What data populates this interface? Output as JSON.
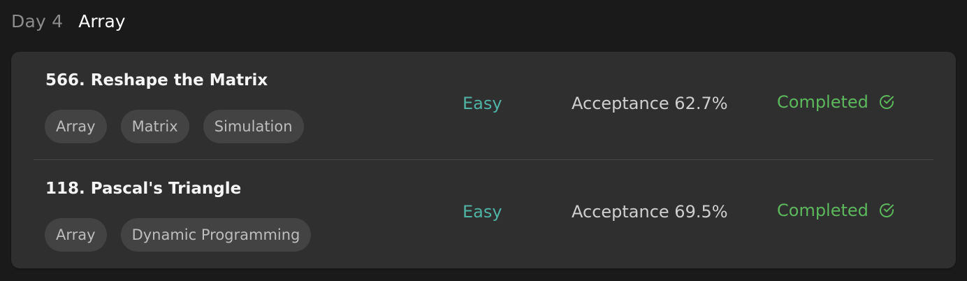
{
  "header": {
    "day_label": "Day 4",
    "section_title": "Array"
  },
  "problems": [
    {
      "title": "566. Reshape the Matrix",
      "tags": [
        "Array",
        "Matrix",
        "Simulation"
      ],
      "difficulty": "Easy",
      "acceptance": "Acceptance 62.7%",
      "status": "Completed",
      "status_icon": "check-circle-icon"
    },
    {
      "title": "118. Pascal's Triangle",
      "tags": [
        "Array",
        "Dynamic Programming"
      ],
      "difficulty": "Easy",
      "acceptance": "Acceptance 69.5%",
      "status": "Completed",
      "status_icon": "check-circle-icon"
    }
  ],
  "colors": {
    "background": "#1a1a1a",
    "card": "#2f2f2f",
    "tag_background": "#434343",
    "easy": "#4fb3a6",
    "completed": "#5cb85c"
  }
}
